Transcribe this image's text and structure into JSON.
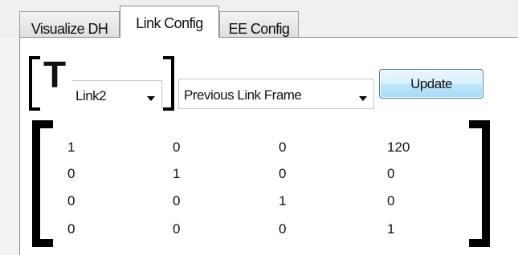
{
  "tabs": [
    {
      "label": "Visualize DH",
      "active": false
    },
    {
      "label": "Link Config",
      "active": true
    },
    {
      "label": "EE Config",
      "active": false
    }
  ],
  "transform": {
    "symbol": "T",
    "link_select": {
      "value": "Link2"
    },
    "frame_select": {
      "value": "Previous Link Frame"
    },
    "update_label": "Update"
  },
  "matrix": [
    [
      "1",
      "0",
      "0",
      "120"
    ],
    [
      "0",
      "1",
      "0",
      "0"
    ],
    [
      "0",
      "0",
      "1",
      "0"
    ],
    [
      "0",
      "0",
      "0",
      "1"
    ]
  ],
  "icons": {
    "combo_arrow": "chevron-down-icon"
  },
  "colors": {
    "button_border": "#3c7fb1",
    "button_fill": "#bee6fd",
    "panel_bg": "#ffffff",
    "tabstrip_bg": "#f0f0f0"
  }
}
